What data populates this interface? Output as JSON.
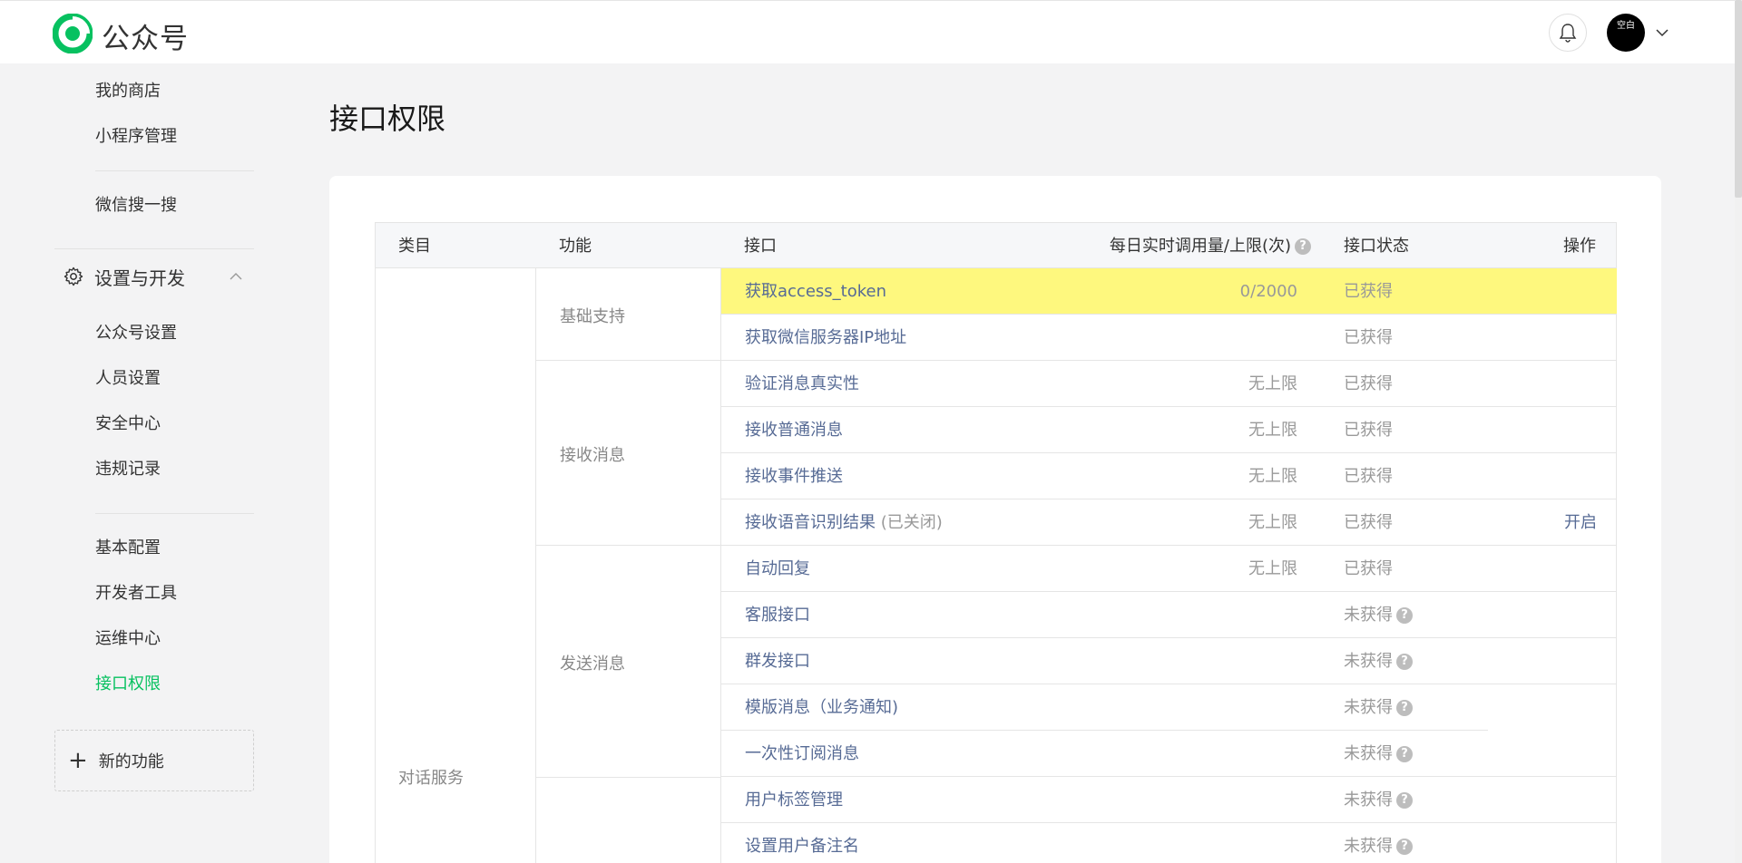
{
  "header": {
    "brand": "公众号",
    "avatar_text": "空白",
    "logo_color": "#07c160"
  },
  "sidebar": {
    "items_top": [
      {
        "label": "我的商店"
      },
      {
        "label": "小程序管理"
      },
      {
        "label": "微信搜一搜"
      }
    ],
    "section": {
      "label": "设置与开发",
      "icon": "gear-icon",
      "expanded": true
    },
    "section_items": [
      {
        "label": "公众号设置"
      },
      {
        "label": "人员设置"
      },
      {
        "label": "安全中心"
      },
      {
        "label": "违规记录"
      },
      {
        "label": "基本配置"
      },
      {
        "label": "开发者工具"
      },
      {
        "label": "运维中心"
      },
      {
        "label": "接口权限",
        "active": true
      }
    ],
    "new_feature": {
      "label": "新的功能"
    },
    "active_color": "#07c160"
  },
  "main": {
    "title": "接口权限",
    "table": {
      "headers": {
        "category": "类目",
        "function": "功能",
        "api": "接口",
        "quota": "每日实时调用量/上限(次)",
        "status": "接口状态",
        "operation": "操作"
      },
      "category": "对话服务",
      "functions": [
        {
          "label": "基础支持"
        },
        {
          "label": "接收消息"
        },
        {
          "label": "发送消息"
        },
        {
          "label": ""
        }
      ],
      "rows": [
        {
          "api": "获取access_token",
          "quota": "0/2000",
          "status": "已获得",
          "highlight": true
        },
        {
          "api": "获取微信服务器IP地址",
          "quota": "",
          "status": "已获得"
        },
        {
          "api": "验证消息真实性",
          "quota": "无上限",
          "status": "已获得"
        },
        {
          "api": "接收普通消息",
          "quota": "无上限",
          "status": "已获得"
        },
        {
          "api": "接收事件推送",
          "quota": "无上限",
          "status": "已获得"
        },
        {
          "api": "接收语音识别结果",
          "api_extra": " (已关闭)",
          "quota": "无上限",
          "status": "已获得",
          "operation": "开启"
        },
        {
          "api": "自动回复",
          "quota": "无上限",
          "status": "已获得"
        },
        {
          "api": "客服接口",
          "quota": "",
          "status": "未获得"
        },
        {
          "api": "群发接口",
          "quota": "",
          "status": "未获得"
        },
        {
          "api": "模版消息（业务通知)",
          "quota": "",
          "status": "未获得"
        },
        {
          "api": "一次性订阅消息",
          "quota": "",
          "status": "未获得"
        },
        {
          "api": "用户标签管理",
          "quota": "",
          "status": "未获得"
        },
        {
          "api": "设置用户备注名",
          "quota": "",
          "status": "未获得"
        }
      ],
      "highlight_color": "#fef87e",
      "link_color": "#576b95"
    }
  }
}
